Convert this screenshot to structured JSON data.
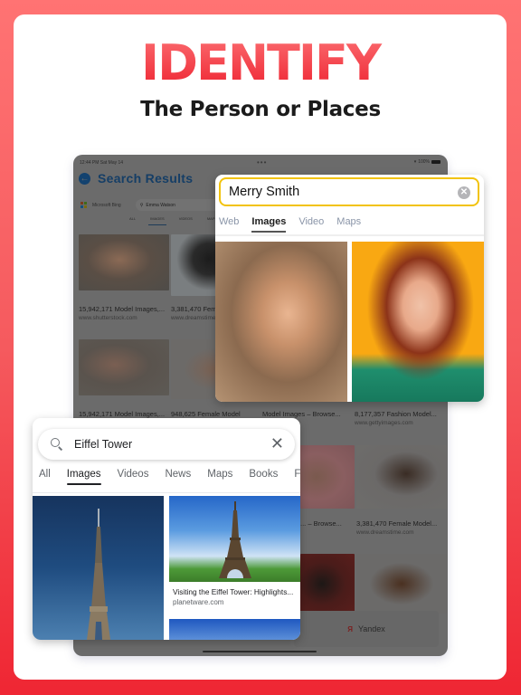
{
  "promo": {
    "headline": "IDENTIFY",
    "subheadline": "The Person or Places",
    "colors": {
      "accent": "#ef2633",
      "accent_light": "#ff7373"
    }
  },
  "tablet": {
    "status_bar": {
      "time": "12:44 PM  Sat May 14",
      "dots": "•••",
      "battery": "100%"
    },
    "title": "Search Results",
    "back_icon": "back-arrow-icon",
    "search_engine": "Microsoft Bing",
    "search_query": "Emma Watson",
    "tabs": [
      "ALL",
      "IMAGES",
      "VIDEOS",
      "MAPS"
    ],
    "active_tab": "IMAGES",
    "results": [
      {
        "title": "15,942,171 Model Images,...",
        "url": "www.shutterstock.com"
      },
      {
        "title": "3,381,470 Female Model...",
        "url": "www.dreamstime.com"
      },
      {
        "title": "15,942,171 Model Images,...",
        "url": ""
      },
      {
        "title": "948,625 Female Model",
        "url": ""
      },
      {
        "title": "Model Images – Browse...",
        "url": "...com"
      },
      {
        "title": "8,177,357 Fashion Model...",
        "url": "www.gettyimages.com"
      },
      {
        "title": "... – Browse...",
        "url": "...com"
      },
      {
        "title": "3,381,470 Female Model...",
        "url": "www.dreamstime.com"
      }
    ],
    "yandex_button": {
      "logo": "Я",
      "label": "Yandex"
    }
  },
  "bing_card": {
    "search_value": "Merry Smith",
    "tabs": [
      "Web",
      "Images",
      "Video",
      "Maps"
    ],
    "active_tab": "Images"
  },
  "google_card": {
    "search_value": "Eiffel Tower",
    "tabs": [
      "All",
      "Images",
      "Videos",
      "News",
      "Maps",
      "Books",
      "Flights"
    ],
    "active_tab": "Images",
    "result": {
      "title": "Visiting the Eiffel Tower: Highlights...",
      "url": "planetware.com"
    }
  }
}
